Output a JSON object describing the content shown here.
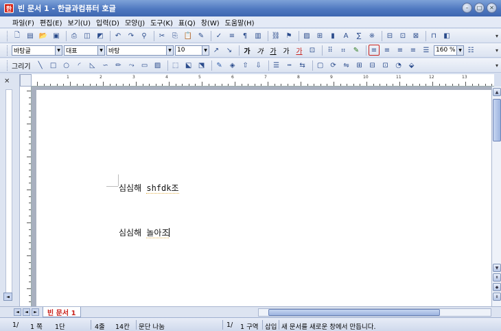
{
  "window": {
    "app_icon": "hangul-app-icon",
    "app_icon_glyph": "한",
    "title": "빈 문서 1 - 한글과컴퓨터 호글"
  },
  "menu": [
    "파일(F)",
    "편집(E)",
    "보기(U)",
    "입력(D)",
    "모양(J)",
    "도구(K)",
    "표(Q)",
    "창(W)",
    "도움말(H)"
  ],
  "format_toolbar": {
    "style": "바탕글",
    "lang": "대표",
    "font": "바탕",
    "size": "10",
    "zoom": "160 %"
  },
  "draw_toolbar": {
    "label": "그리기"
  },
  "ruler_numbers": [
    "1",
    "2",
    "3",
    "4",
    "5",
    "6",
    "7",
    "8",
    "9",
    "10",
    "11",
    "12",
    "13",
    "14"
  ],
  "document": {
    "line1_a": "심심해 ",
    "line1_b": "shfdk조",
    "line2_a": "심심해 ",
    "line2_b": "놀아조"
  },
  "tab": {
    "label": "빈 문서 1"
  },
  "status": {
    "page": "1/",
    "section": "1 쪽",
    "column": "1단",
    "line": "4줄",
    "col": "14칸",
    "break": "문단 나눔",
    "pos": "1/",
    "area": "1 구역",
    "mode": "삽입",
    "message": "새 문서를 새로운 창에서 만듭니다."
  },
  "colors": {
    "title_bar": "#4f78c0",
    "tab_text": "#c8201a"
  }
}
